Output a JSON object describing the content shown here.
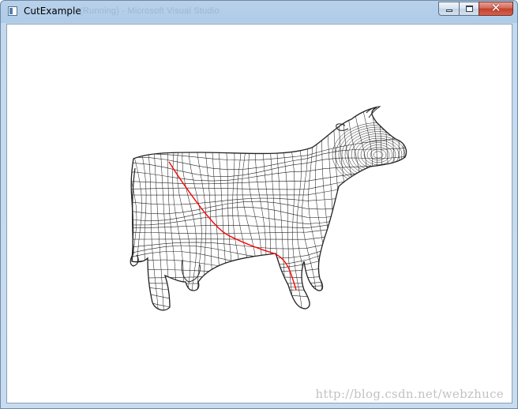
{
  "window": {
    "title": "CutExample",
    "background_title": "(Running) - Microsoft Visual Studio",
    "controls": {
      "minimize": "minimize",
      "maximize": "maximize",
      "close": "✕"
    }
  },
  "viewport": {
    "content": "wireframe-cow-mesh",
    "mesh_color": "#222222",
    "cut_color": "#ff0000",
    "background": "#ffffff"
  },
  "watermark": "http://blog.csdn.net/webzhuce"
}
